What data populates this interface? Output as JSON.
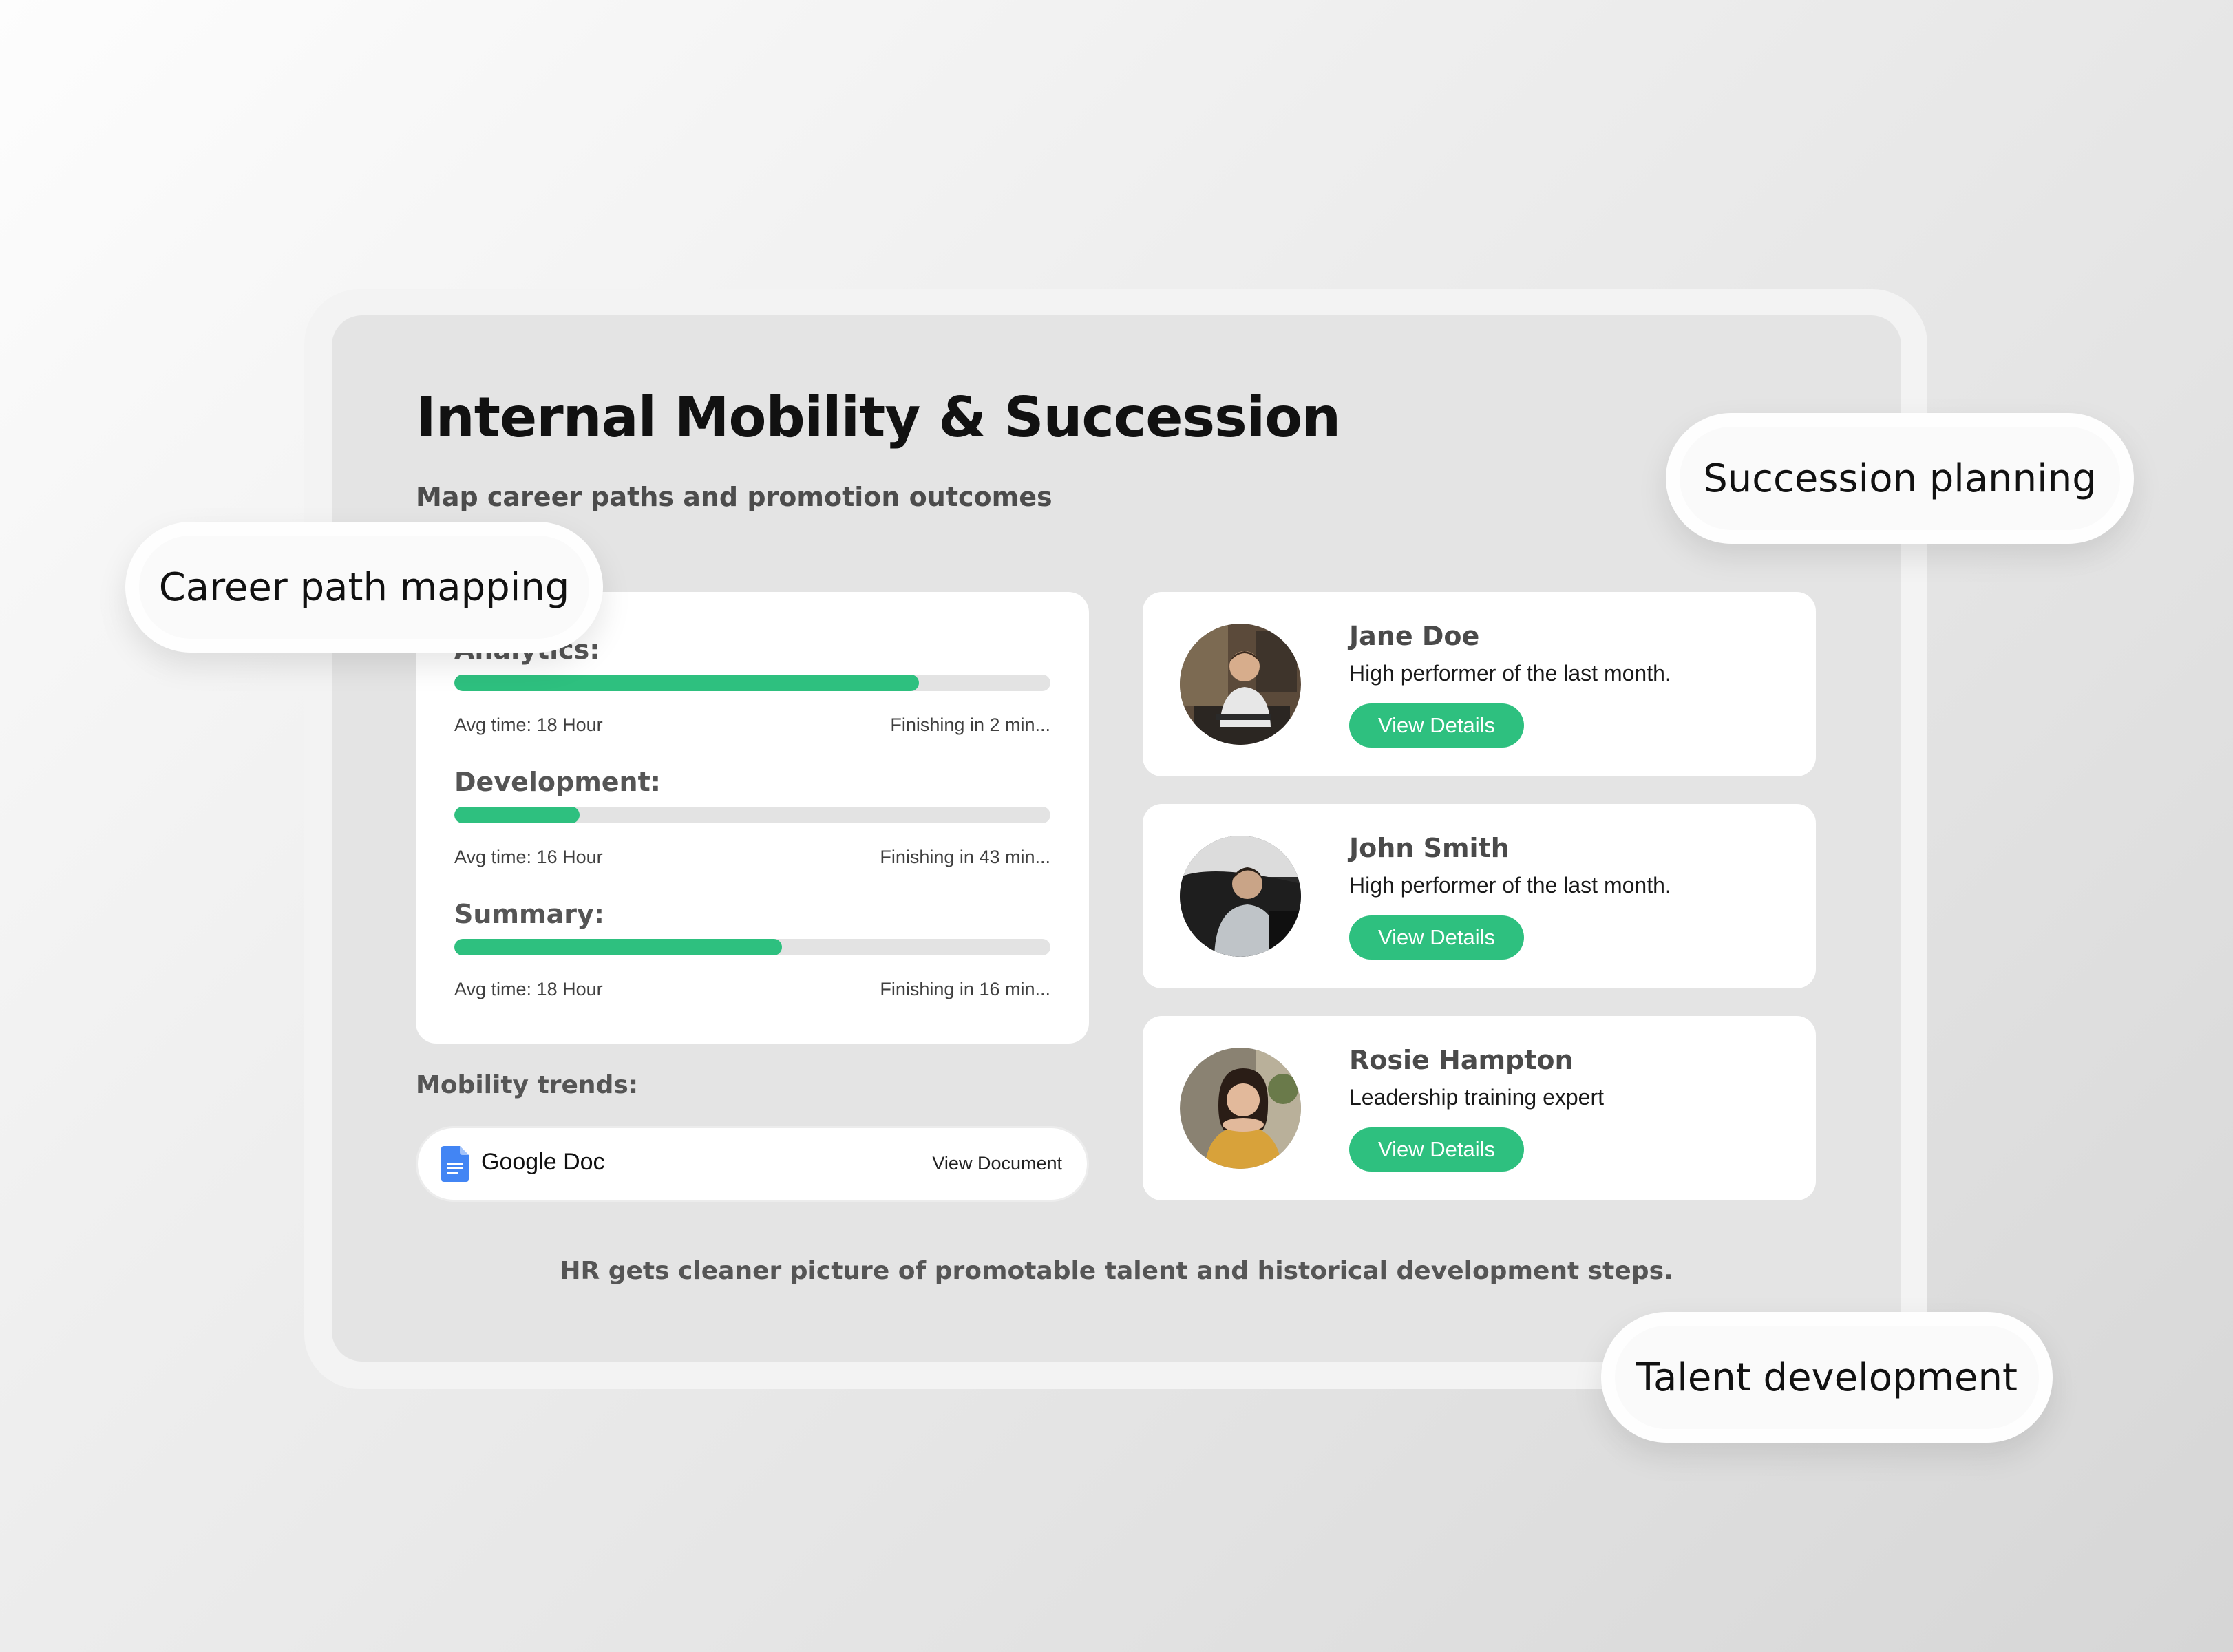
{
  "header": {
    "title": "Internal Mobility & Succession",
    "subtitle": "Map career paths and promotion outcomes"
  },
  "progress": {
    "tasks": [
      {
        "label": "Analytics:",
        "progress_percent": 78,
        "avg_time": "Avg time: 18 Hour",
        "finishing": "Finishing in 2 min..."
      },
      {
        "label": "Development:",
        "progress_percent": 21,
        "avg_time": "Avg time: 16 Hour",
        "finishing": "Finishing in 43 min..."
      },
      {
        "label": "Summary:",
        "progress_percent": 55,
        "avg_time": "Avg time: 18 Hour",
        "finishing": "Finishing in 16 min..."
      }
    ],
    "bar_color": "#2EC07F",
    "track_color": "#E3E3E3"
  },
  "mobility": {
    "label": "Mobility trends:",
    "document": {
      "name": "Google Doc",
      "icon": "google-doc-icon",
      "action": "View Document"
    }
  },
  "people": [
    {
      "name": "Jane Doe",
      "description": "High performer of the last month.",
      "button": "View Details",
      "avatar": "avatar-photo"
    },
    {
      "name": "John Smith",
      "description": "High performer of the last month.",
      "button": "View Details",
      "avatar": "avatar-photo"
    },
    {
      "name": "Rosie Hampton",
      "description": "Leadership training expert",
      "button": "View Details",
      "avatar": "avatar-photo"
    }
  ],
  "footer": {
    "text": "HR gets cleaner picture of promotable talent and historical development steps."
  },
  "tags": {
    "career": "Career path mapping",
    "succession": "Succession planning",
    "talent": "Talent development"
  },
  "colors": {
    "accent": "#2EC07F",
    "doc_blue": "#4285F4"
  }
}
